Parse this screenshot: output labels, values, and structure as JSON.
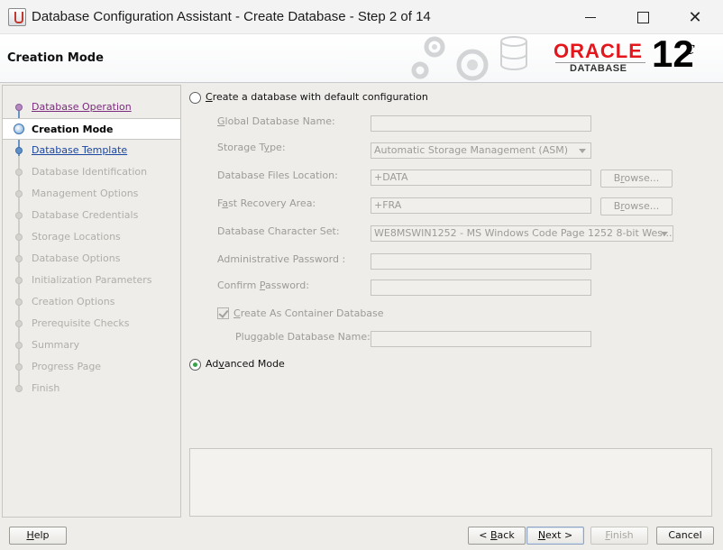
{
  "window": {
    "title": "Database Configuration Assistant - Create Database - Step 2 of 14",
    "close_glyph": "✕"
  },
  "banner": {
    "title": "Creation Mode",
    "brand": "ORACLE",
    "brand_sub": "DATABASE",
    "version": "12",
    "version_suffix": "c"
  },
  "sidebar": {
    "items": [
      {
        "label": "Database Operation",
        "state": "done"
      },
      {
        "label": "Creation Mode",
        "state": "current"
      },
      {
        "label": "Database Template",
        "state": "next"
      },
      {
        "label": "Database Identification",
        "state": "pending"
      },
      {
        "label": "Management Options",
        "state": "pending"
      },
      {
        "label": "Database Credentials",
        "state": "pending"
      },
      {
        "label": "Storage Locations",
        "state": "pending"
      },
      {
        "label": "Database Options",
        "state": "pending"
      },
      {
        "label": "Initialization Parameters",
        "state": "pending"
      },
      {
        "label": "Creation Options",
        "state": "pending"
      },
      {
        "label": "Prerequisite Checks",
        "state": "pending"
      },
      {
        "label": "Summary",
        "state": "pending"
      },
      {
        "label": "Progress Page",
        "state": "pending"
      },
      {
        "label": "Finish",
        "state": "pending"
      }
    ]
  },
  "form": {
    "default_option": {
      "mn": "C",
      "rest": "reate a database with default configuration",
      "selected": false
    },
    "fields": {
      "global_db_name": {
        "mn": "G",
        "rest": "lobal Database Name:",
        "value": ""
      },
      "storage_type": {
        "mn": "",
        "before": "Storage T",
        "mnc": "y",
        "rest": "pe:",
        "value": "Automatic Storage Management (ASM)"
      },
      "db_files_location": {
        "label": "Database Files Location:",
        "value": "+DATA"
      },
      "fast_recovery": {
        "before": "F",
        "mnc": "a",
        "rest": "st Recovery Area:",
        "value": "+FRA"
      },
      "charset": {
        "label": "Database Character Set:",
        "value": "WE8MSWIN1252 - MS Windows Code Page 1252 8-bit Wes..."
      },
      "admin_password": {
        "label": "Administrative Password :",
        "value": ""
      },
      "confirm_password": {
        "before": "Confirm ",
        "mnc": "P",
        "rest": "assword:",
        "value": ""
      },
      "container_db": {
        "mn": "C",
        "rest": "reate As Container Database",
        "checked": true
      },
      "pdb_name": {
        "label": "Pluggable Database Name:",
        "value": ""
      }
    },
    "browse_label": {
      "before": "B",
      "mnc": "r",
      "rest": "owse..."
    },
    "advanced_option": {
      "before": "Ad",
      "mnc": "v",
      "rest": "anced Mode",
      "selected": true
    }
  },
  "buttons": {
    "help": {
      "mn": "H",
      "rest": "elp"
    },
    "back": {
      "before": "< ",
      "mnc": "B",
      "rest": "ack"
    },
    "next": {
      "mn": "N",
      "rest": "ext >"
    },
    "finish": {
      "mn": "F",
      "rest": "inish"
    },
    "cancel": "Cancel"
  },
  "colors": {
    "accent": "#1b46a0",
    "visited": "#7b2a7e",
    "oracle_red": "#e4161b",
    "selected_radio": "#3aa34a"
  }
}
